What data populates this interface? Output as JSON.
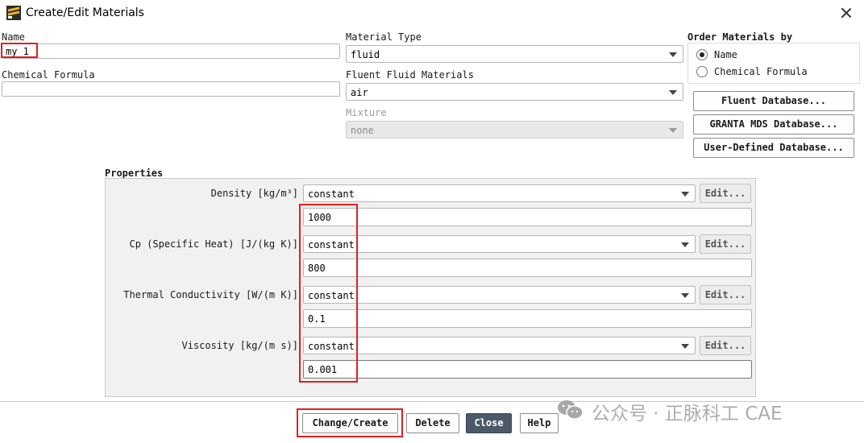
{
  "window": {
    "title": "Create/Edit Materials",
    "icon": "fluent-app-icon",
    "close_icon": "close-icon"
  },
  "name_field": {
    "label": "Name",
    "value": "my 1"
  },
  "chemical_formula_field": {
    "label": "Chemical Formula",
    "value": ""
  },
  "material_type": {
    "label": "Material Type",
    "value": "fluid"
  },
  "fluent_fluid_materials": {
    "label": "Fluent Fluid Materials",
    "value": "air"
  },
  "mixture": {
    "label": "Mixture",
    "value": "none",
    "disabled": true
  },
  "order_by": {
    "label": "Order Materials by",
    "options": [
      {
        "label": "Name",
        "checked": true
      },
      {
        "label": "Chemical Formula",
        "checked": false
      }
    ]
  },
  "database_buttons": [
    "Fluent Database...",
    "GRANTA MDS Database...",
    "User-Defined Database..."
  ],
  "properties": {
    "label": "Properties",
    "edit_label": "Edit...",
    "items": [
      {
        "label": "Density [kg/m³]",
        "method": "constant",
        "value": "1000"
      },
      {
        "label": "Cp (Specific Heat) [J/(kg K)]",
        "method": "constant",
        "value": "800"
      },
      {
        "label": "Thermal Conductivity [W/(m K)]",
        "method": "constant",
        "value": "0.1"
      },
      {
        "label": "Viscosity [kg/(m s)]",
        "method": "constant",
        "value": "0.001"
      }
    ]
  },
  "footer_buttons": {
    "change_create": "Change/Create",
    "delete": "Delete",
    "close": "Close",
    "help": "Help"
  },
  "watermark": {
    "text": "公众号 · 正脉科工 CAE",
    "icon": "wechat-icon"
  },
  "colors": {
    "highlight": "#e02020",
    "close_button": "#4b5a66",
    "panel_bg": "#f1f1f1"
  }
}
